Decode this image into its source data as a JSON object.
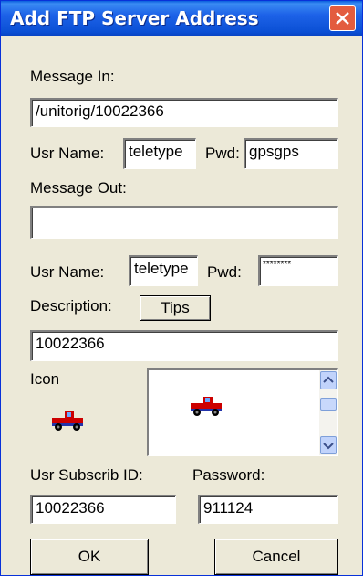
{
  "window": {
    "title": "Add FTP Server Address"
  },
  "message_in": {
    "label": "Message In:",
    "path": "/unitorig/10022366"
  },
  "in_credentials": {
    "user_label": "Usr Name:",
    "user_value": "teletype",
    "pwd_label": "Pwd:",
    "pwd_value": "gpsgps"
  },
  "message_out": {
    "label": "Message Out:",
    "path": ""
  },
  "out_credentials": {
    "user_label": "Usr Name:",
    "user_value": "teletype",
    "pwd_label": "Pwd:",
    "pwd_value": "********"
  },
  "description": {
    "label": "Description:",
    "tips_label": "Tips",
    "value": "10022366"
  },
  "icon": {
    "label": "Icon",
    "selected_icon": "red-pickup-truck-icon"
  },
  "subscription": {
    "id_label": "Usr Subscrib ID:",
    "id_value": "10022366",
    "password_label": "Password:",
    "password_value": "911124"
  },
  "buttons": {
    "ok": "OK",
    "cancel": "Cancel"
  },
  "colors": {
    "title_bar": "#1d62e8",
    "close_button": "#e35c3f",
    "dialog_bg": "#ece9d8"
  }
}
